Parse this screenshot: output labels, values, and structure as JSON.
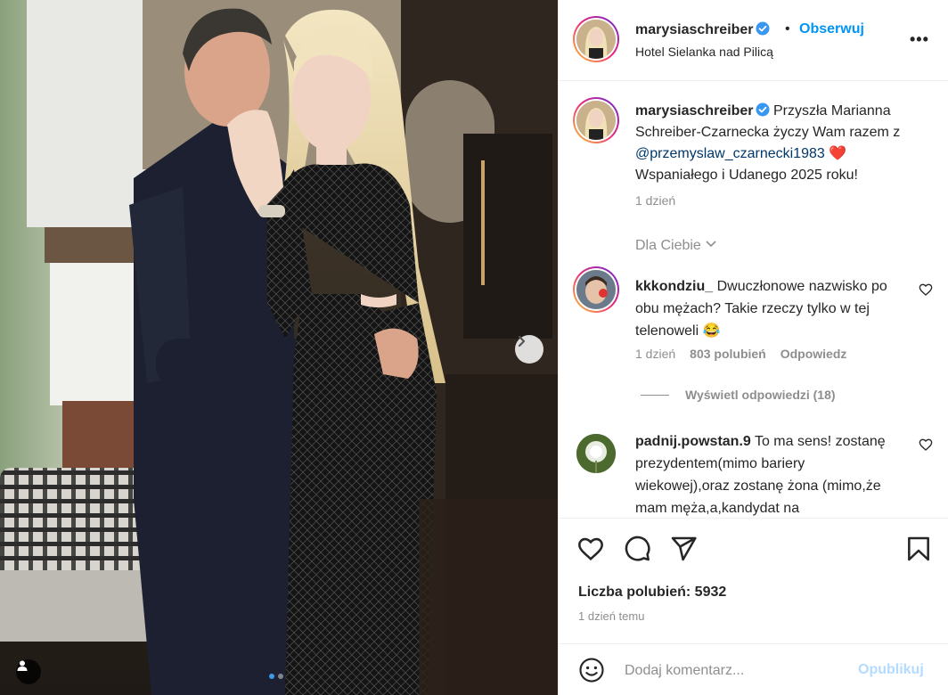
{
  "header": {
    "username": "marysiaschreiber",
    "separator": "•",
    "follow_label": "Obserwuj",
    "location": "Hotel Sielanka nad Pilicą",
    "more_label": "•••"
  },
  "caption": {
    "username": "marysiaschreiber",
    "text_before": "Przyszła Marianna Schreiber-Czarnecka życzy Wam razem z ",
    "mention": "@przemyslaw_czarnecki1983",
    "text_after": " Wspaniałego i Udanego 2025 roku!",
    "emoji": "❤️",
    "time": "1 dzień"
  },
  "comments_filter": "Dla Ciebie",
  "comments": [
    {
      "username": "kkkondziu_",
      "text": "Dwuczłonowe nazwisko po obu mężach? Takie rzeczy tylko w tej telenoweli",
      "emoji": "😂",
      "time": "1 dzień",
      "likes": "803 polubień",
      "reply_label": "Odpowiedz",
      "view_replies": "Wyświetl odpowiedzi (18)"
    },
    {
      "username": "padnij.powstan.9",
      "text": "To ma sens! zostanę prezydentem(mimo bariery wiekowej),oraz zostanę żona (mimo,że mam męża,a,kandydat na"
    }
  ],
  "actions": {
    "likes_text": "Liczba polubień: 5932",
    "time_ago": "1 dzień temu"
  },
  "comment_box": {
    "placeholder": "Dodaj komentarz...",
    "publish_label": "Opublikuj"
  },
  "carousel": {
    "current": 1,
    "total": 2
  },
  "colors": {
    "accent": "#0095f6",
    "verified": "#3897f0",
    "heart": "#ed4956"
  }
}
